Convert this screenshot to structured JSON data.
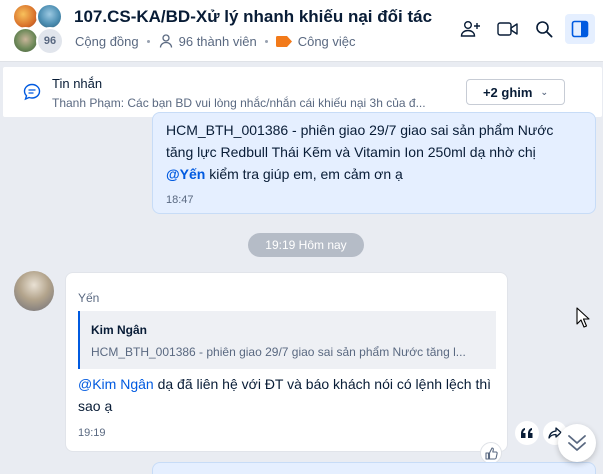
{
  "header": {
    "title": "107.CS-KA/BD-Xử lý nhanh khiếu nại đối tác",
    "member_count_badge": "96",
    "community_label": "Cộng đồng",
    "members_label": "96 thành viên",
    "category_label": "Công việc",
    "category_color": "#f27a1a",
    "icons": [
      "add-member-icon",
      "video-call-icon",
      "search-icon",
      "sidebar-toggle-icon"
    ]
  },
  "pinned": {
    "label": "Tin nhắn",
    "text": "Thanh Phạm: Các bạn BD vui lòng nhắc/nhắn cái khiếu nại 3h của đ...",
    "more_label": "+2 ghim"
  },
  "messages": {
    "self": {
      "line1": "HCM_BTH_001386 - phiên giao 29/7 giao sai sản phẩm Nước",
      "line2": "tăng lực Redbull Thái Kẽm và Vitamin Ion 250ml dạ nhờ chị",
      "mention": "@Yến",
      "line3_rest": " kiểm tra giúp em, em cảm ơn ạ",
      "time": "18:47"
    },
    "date_separator": "19:19 Hôm nay",
    "other": {
      "sender": "Yến",
      "quote_name": "Kim Ngân",
      "quote_text": "HCM_BTH_001386 - phiên giao 29/7 giao sai sản phẩm Nước tăng l...",
      "mention": "@Kim Ngân",
      "text": " dạ đã liên hệ với ĐT và báo khách nói có lệnh lệch thì sao ạ",
      "time": "19:19"
    }
  },
  "accent_color": "#005ae0"
}
